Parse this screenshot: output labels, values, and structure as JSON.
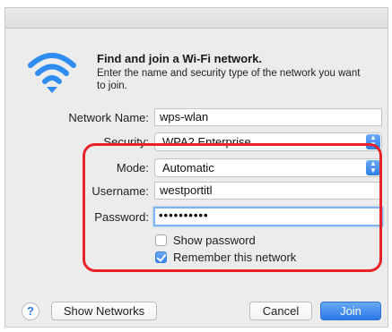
{
  "dialog": {
    "heading": "Find and join a Wi-Fi network.",
    "description": "Enter the name and security type of the network you want to join."
  },
  "form": {
    "network_name_label": "Network Name:",
    "network_name_value": "wps-wlan",
    "security_label": "Security:",
    "security_value": "WPA2 Enterprise",
    "mode_label": "Mode:",
    "mode_value": "Automatic",
    "username_label": "Username:",
    "username_value": "westportitl",
    "password_label": "Password:",
    "password_value": "••••••••••",
    "show_password_label": "Show password",
    "show_password_checked": false,
    "remember_label": "Remember this network",
    "remember_checked": true
  },
  "footer": {
    "help_label": "?",
    "show_networks_label": "Show Networks",
    "cancel_label": "Cancel",
    "join_label": "Join"
  },
  "icons": {
    "wifi": "wifi-icon",
    "select_arrows": "updown-chevron-icon",
    "help": "question-mark-icon"
  },
  "colors": {
    "accent": "#2f7ce8",
    "highlight_annotation": "#e8232a",
    "dialog_background": "#ececec"
  }
}
